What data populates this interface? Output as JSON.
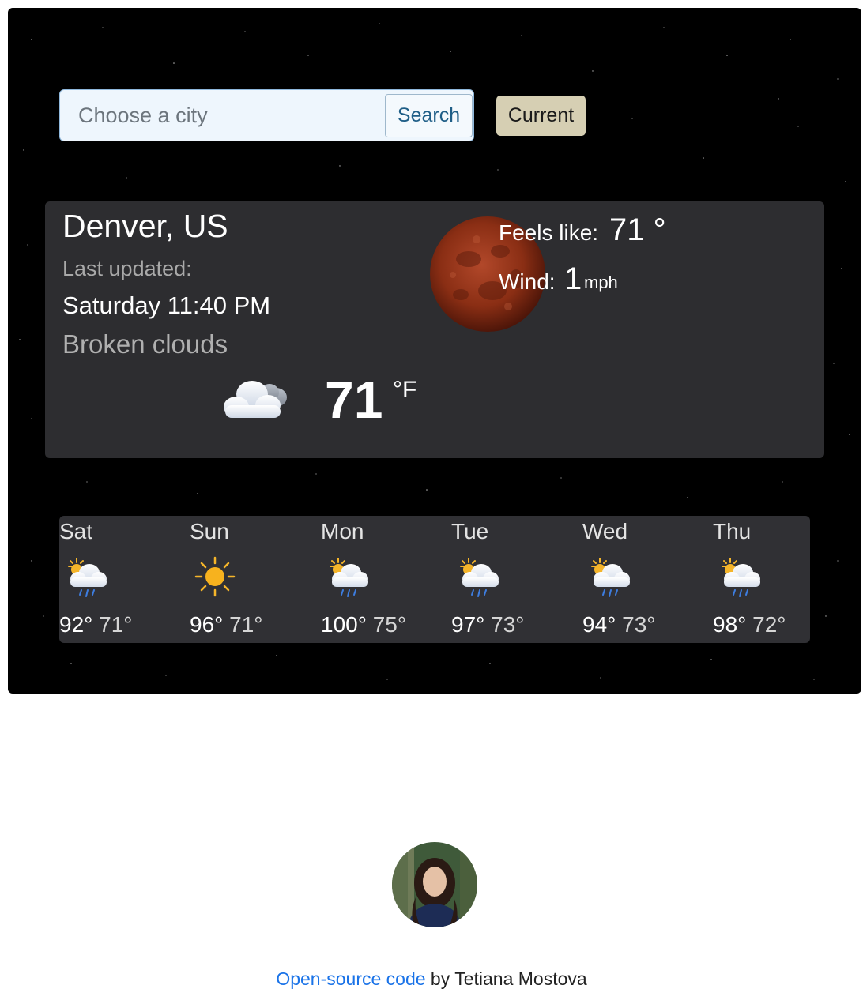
{
  "search": {
    "placeholder": "Choose a city",
    "button_label": "Search"
  },
  "current_button_label": "Current",
  "current": {
    "city": "Denver, US",
    "last_updated_label": "Last updated:",
    "updated_time": "Saturday 11:40 PM",
    "description": "Broken clouds",
    "icon": "broken-clouds-icon",
    "temperature": "71",
    "unit": "°F",
    "feels_like_label": "Feels like:",
    "feels_like_value": "71 °",
    "wind_label": "Wind:",
    "wind_value": "1",
    "wind_unit": "mph"
  },
  "forecast": [
    {
      "day": "Sat",
      "icon": "sun-cloud-rain-icon",
      "max": "92°",
      "min": "71°"
    },
    {
      "day": "Sun",
      "icon": "sun-icon",
      "max": "96°",
      "min": "71°"
    },
    {
      "day": "Mon",
      "icon": "sun-cloud-rain-icon",
      "max": "100°",
      "min": "75°"
    },
    {
      "day": "Tue",
      "icon": "sun-cloud-rain-icon",
      "max": "97°",
      "min": "73°"
    },
    {
      "day": "Wed",
      "icon": "sun-cloud-rain-icon",
      "max": "94°",
      "min": "73°"
    },
    {
      "day": "Thu",
      "icon": "sun-cloud-rain-icon",
      "max": "98°",
      "min": "72°"
    }
  ],
  "footer": {
    "link_text": "Open-source code",
    "author_text": " by Tetiana Mostova"
  },
  "colors": {
    "current_button_bg": "#d6cfb3",
    "card_bg": "#303034",
    "link": "#1a73e8",
    "moon": "#8a2e14"
  }
}
